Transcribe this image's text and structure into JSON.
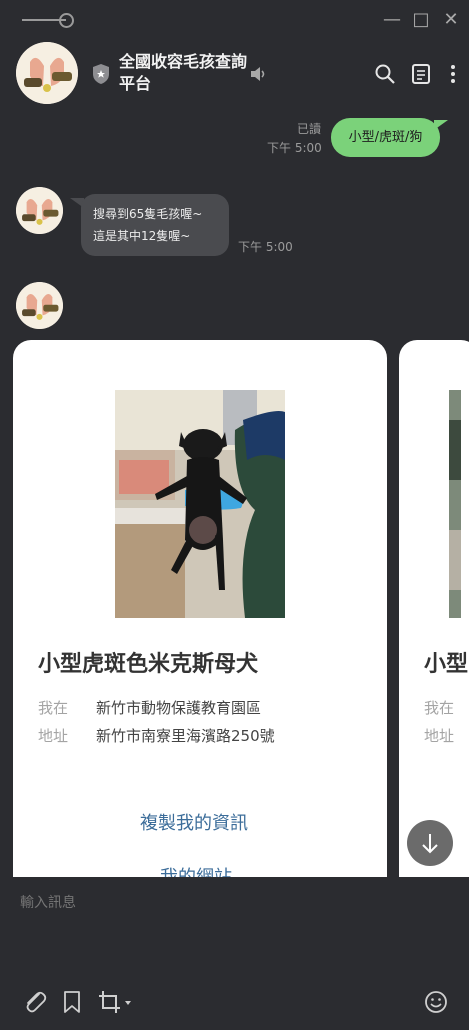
{
  "window": {
    "controls": {
      "minimize": "—",
      "maximize": "□",
      "close": "✕"
    }
  },
  "header": {
    "title": "全國收容毛孩查詢平台",
    "icons": [
      "shield-star-icon",
      "speaker-icon",
      "search-icon",
      "notes-icon",
      "more-icon"
    ]
  },
  "messages": {
    "sent": {
      "text": "小型/虎斑/狗",
      "read_label": "已讀",
      "time": "下午 5:00"
    },
    "received": {
      "line1": "搜尋到65隻毛孩喔~",
      "line2": "這是其中12隻喔~",
      "time": "下午 5:00"
    }
  },
  "cards": [
    {
      "title": "小型虎斑色米克斯母犬",
      "location_label": "我在",
      "location_value": "新竹市動物保護教育園區",
      "address_label": "地址",
      "address_value": "新竹市南寮里海濱路250號",
      "copy_link": "複製我的資訊",
      "site_link": "我的網站"
    },
    {
      "title_partial": "小型",
      "location_label": "我在",
      "address_label": "地址"
    }
  ],
  "input": {
    "placeholder": "輸入訊息"
  },
  "toolbar": {
    "icons": [
      "paperclip-icon",
      "bookmark-icon",
      "crop-icon",
      "emoji-icon"
    ]
  },
  "colors": {
    "background": "#2b2c30",
    "sent_bubble": "#7bd27a",
    "received_bubble": "#4a4b4f",
    "link": "#3c6d9a"
  }
}
